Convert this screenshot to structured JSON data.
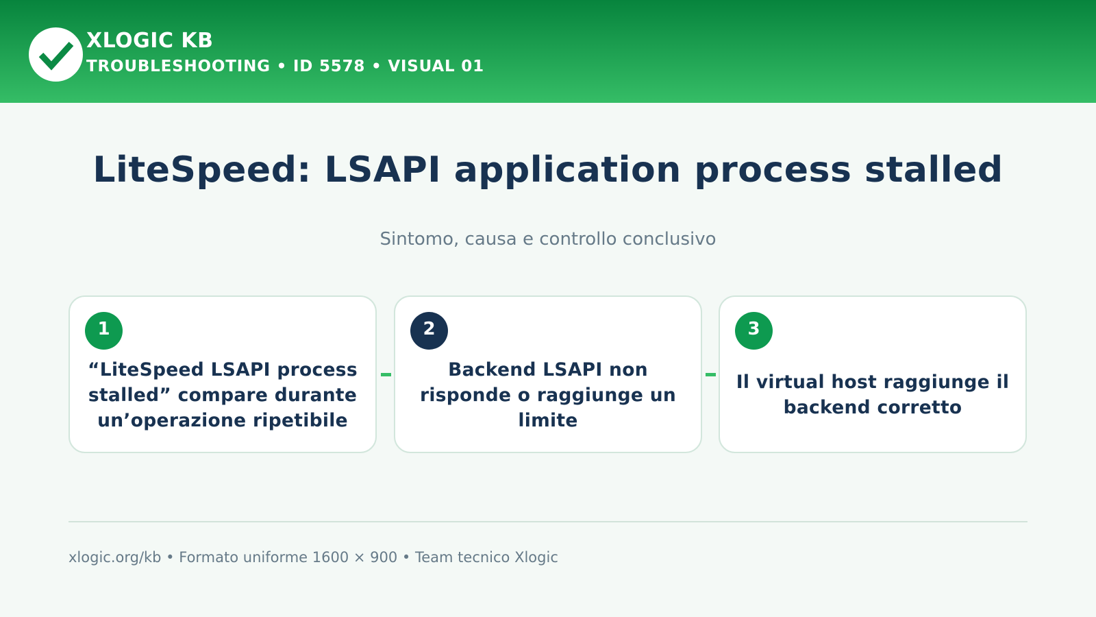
{
  "header": {
    "logo_icon": "check-icon",
    "brand": "XLOGIC KB",
    "subtitle": "TROUBLESHOOTING • ID 5578 • VISUAL 01",
    "gradient_top": "#07843d",
    "gradient_bottom": "#35bd66"
  },
  "main": {
    "title": "LiteSpeed: LSAPI application process stalled",
    "subtitle": "Sintomo, causa e controllo conclusivo"
  },
  "steps": [
    {
      "number": "1",
      "text": "“LiteSpeed LSAPI process stalled” compare durante un’operazione ripetibile",
      "badge_color": "#0e9a50"
    },
    {
      "number": "2",
      "text": "Backend LSAPI non risponde o raggiunge un limite",
      "badge_color": "#183251"
    },
    {
      "number": "3",
      "text": "Il virtual host raggiunge il backend corretto",
      "badge_color": "#0e9a50"
    }
  ],
  "footer": {
    "text": "xlogic.org/kb • Formato uniforme 1600 × 900 • Team tecnico Xlogic"
  },
  "colors": {
    "navy": "#183251",
    "muted": "#667a88",
    "accent": "#35bd66",
    "background": "#f4f9f6"
  }
}
